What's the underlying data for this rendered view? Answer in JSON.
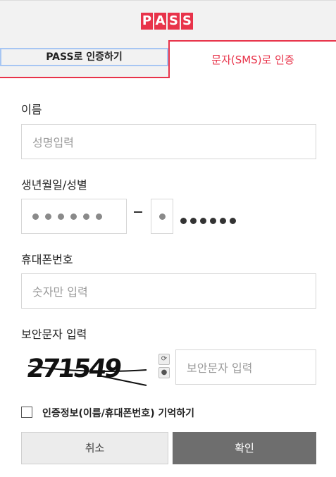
{
  "logo": {
    "letters": [
      "P",
      "A",
      "S",
      "S"
    ]
  },
  "tabs": {
    "pass_label": "PASS로 인증하기",
    "sms_label": "문자(SMS)로 인증"
  },
  "name": {
    "label": "이름",
    "placeholder": "성명입력"
  },
  "birth": {
    "label": "생년월일/성별",
    "dash": "–"
  },
  "phone": {
    "label": "휴대폰번호",
    "placeholder": "숫자만 입력"
  },
  "captcha": {
    "label": "보안문자 입력",
    "code": "271549",
    "placeholder": "보안문자 입력",
    "refresh_icon": "refresh-icon",
    "audio_icon": "speaker-icon"
  },
  "remember": {
    "label": "인증정보(이름/휴대폰번호) 기억하기",
    "checked": false
  },
  "buttons": {
    "cancel": "취소",
    "confirm": "확인"
  },
  "colors": {
    "brand": "#e8334a",
    "tab_focus": "#a7c6f3",
    "confirm_bg": "#6e6e6e"
  }
}
